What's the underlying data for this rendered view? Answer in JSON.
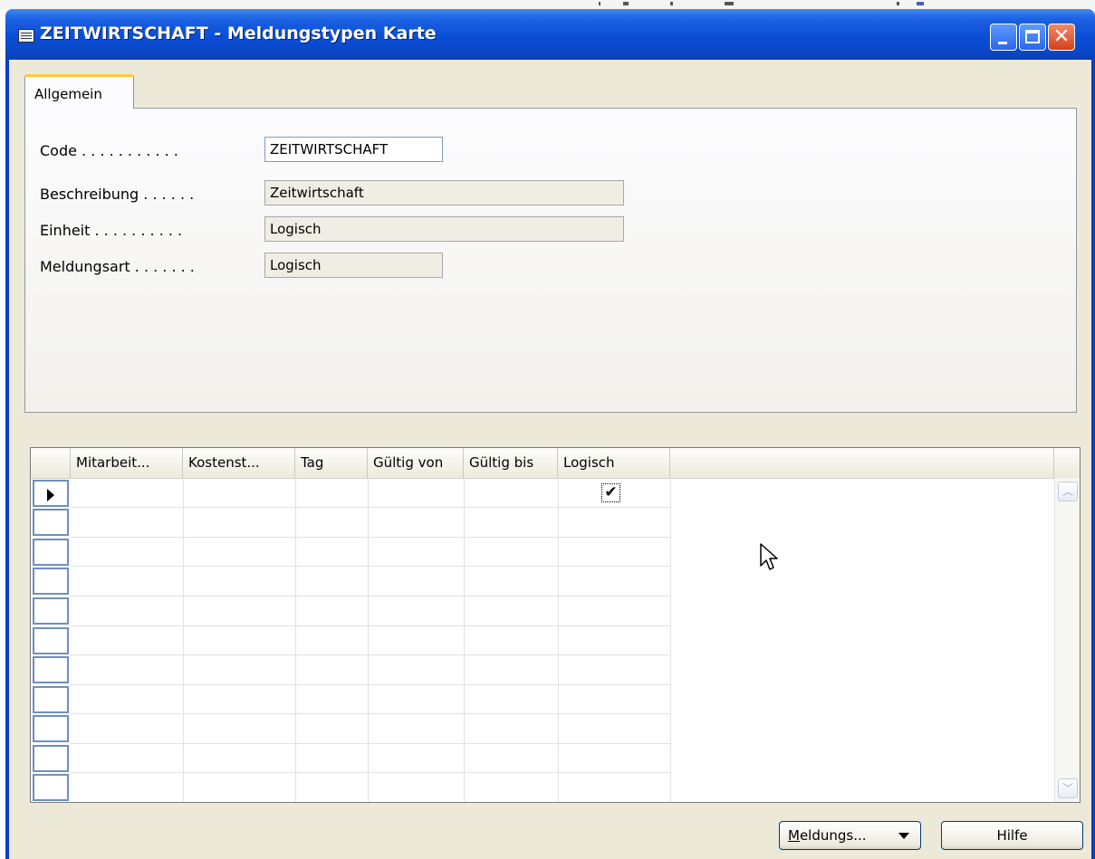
{
  "window": {
    "title": "ZEITWIRTSCHAFT - Meldungstypen Karte",
    "controls": [
      "minimize",
      "maximize",
      "close"
    ]
  },
  "tabs": [
    {
      "label": "Allgemein",
      "active": true
    }
  ],
  "form": {
    "fields": [
      {
        "label": "Code . . . . . . . . . . .",
        "value": "ZEITWIRTSCHAFT",
        "editable": true
      },
      {
        "label": "Beschreibung . . . . . .",
        "value": "Zeitwirtschaft",
        "editable": false
      },
      {
        "label": "Einheit . . . . . . . . . .",
        "value": "Logisch",
        "editable": false
      },
      {
        "label": "Meldungsart . . . . . . .",
        "value": "Logisch",
        "editable": false
      }
    ]
  },
  "grid": {
    "columns": [
      "Mitarbeit...",
      "Kostenst...",
      "Tag",
      "Gültig von",
      "Gültig bis",
      "Logisch"
    ],
    "current_row": {
      "logisch_checked": true,
      "check_glyph": "✔"
    },
    "empty_rows": 10,
    "scroll_up": "︿",
    "scroll_down": "﹀"
  },
  "buttons": {
    "meldungs_label": "Meldungs...",
    "meldungs_underline": "M",
    "meldungs_rest": "eldungs...",
    "hilfe_label": "Hilfe"
  },
  "colors": {
    "titlebar": "#0a4ed6",
    "tab_accent": "#ffc83c",
    "client_bg": "#ece9d8"
  },
  "icons": {
    "app": "table-icon",
    "cursor": "mouse-pointer-icon",
    "row_indicator": "row-pointer-icon"
  }
}
